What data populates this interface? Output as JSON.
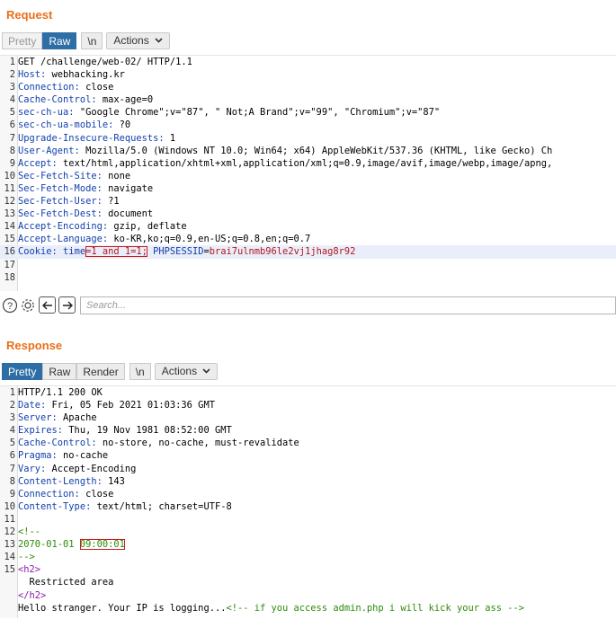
{
  "request": {
    "title": "Request",
    "toolbar": {
      "pretty": "Pretty",
      "raw": "Raw",
      "newline": "\\n",
      "actions": "Actions"
    },
    "lines": [
      {
        "n": "1",
        "parts": [
          {
            "t": "GET /challenge/web-02/ HTTP/1.1",
            "c": "hv"
          }
        ]
      },
      {
        "n": "2",
        "parts": [
          {
            "t": "Host:",
            "c": "hk"
          },
          {
            "t": " webhacking.kr",
            "c": "hv"
          }
        ]
      },
      {
        "n": "3",
        "parts": [
          {
            "t": "Connection:",
            "c": "hk"
          },
          {
            "t": " close",
            "c": "hv"
          }
        ]
      },
      {
        "n": "4",
        "parts": [
          {
            "t": "Cache-Control:",
            "c": "hk"
          },
          {
            "t": " max-age=0",
            "c": "hv"
          }
        ]
      },
      {
        "n": "5",
        "parts": [
          {
            "t": "sec-ch-ua:",
            "c": "hk"
          },
          {
            "t": " \"Google Chrome\";v=\"87\", \" Not;A Brand\";v=\"99\", \"Chromium\";v=\"87\"",
            "c": "hv"
          }
        ]
      },
      {
        "n": "6",
        "parts": [
          {
            "t": "sec-ch-ua-mobile:",
            "c": "hk"
          },
          {
            "t": " ?0",
            "c": "hv"
          }
        ]
      },
      {
        "n": "7",
        "parts": [
          {
            "t": "Upgrade-Insecure-Requests:",
            "c": "hk"
          },
          {
            "t": " 1",
            "c": "hv"
          }
        ]
      },
      {
        "n": "8",
        "parts": [
          {
            "t": "User-Agent:",
            "c": "hk"
          },
          {
            "t": " Mozilla/5.0 (Windows NT 10.0; Win64; x64) AppleWebKit/537.36 (KHTML, like Gecko) Ch",
            "c": "hv"
          }
        ]
      },
      {
        "n": "9",
        "parts": [
          {
            "t": "Accept:",
            "c": "hk"
          },
          {
            "t": " text/html,application/xhtml+xml,application/xml;q=0.9,image/avif,image/webp,image/apng,",
            "c": "hv"
          }
        ]
      },
      {
        "n": "10",
        "parts": [
          {
            "t": "Sec-Fetch-Site:",
            "c": "hk"
          },
          {
            "t": " none",
            "c": "hv"
          }
        ]
      },
      {
        "n": "11",
        "parts": [
          {
            "t": "Sec-Fetch-Mode:",
            "c": "hk"
          },
          {
            "t": " navigate",
            "c": "hv"
          }
        ]
      },
      {
        "n": "12",
        "parts": [
          {
            "t": "Sec-Fetch-User:",
            "c": "hk"
          },
          {
            "t": " ?1",
            "c": "hv"
          }
        ]
      },
      {
        "n": "13",
        "parts": [
          {
            "t": "Sec-Fetch-Dest:",
            "c": "hk"
          },
          {
            "t": " document",
            "c": "hv"
          }
        ]
      },
      {
        "n": "14",
        "parts": [
          {
            "t": "Accept-Encoding:",
            "c": "hk"
          },
          {
            "t": " gzip, deflate",
            "c": "hv"
          }
        ]
      },
      {
        "n": "15",
        "parts": [
          {
            "t": "Accept-Language:",
            "c": "hk"
          },
          {
            "t": " ko-KR,ko;q=0.9,en-US;q=0.8,en;q=0.7",
            "c": "hv"
          }
        ]
      },
      {
        "n": "16",
        "selected": true,
        "parts": [
          {
            "t": "Cookie:",
            "c": "hk"
          },
          {
            "t": " time",
            "c": "ck"
          },
          {
            "t": "=1 and 1=1;",
            "c": "cv",
            "boxed": true
          },
          {
            "t": " PHPSESSID",
            "c": "ck"
          },
          {
            "t": "=",
            "c": "hv"
          },
          {
            "t": "brai7ulnmb96le2vj1jhag8r92",
            "c": "cv"
          }
        ]
      },
      {
        "n": "17",
        "parts": []
      },
      {
        "n": "18",
        "parts": []
      }
    ]
  },
  "search": {
    "placeholder": "Search..."
  },
  "response": {
    "title": "Response",
    "toolbar": {
      "pretty": "Pretty",
      "raw": "Raw",
      "render": "Render",
      "newline": "\\n",
      "actions": "Actions"
    },
    "lines": [
      {
        "n": "1",
        "parts": [
          {
            "t": "HTTP/1.1 200 OK",
            "c": "hv"
          }
        ]
      },
      {
        "n": "2",
        "parts": [
          {
            "t": "Date:",
            "c": "hk"
          },
          {
            "t": " Fri, 05 Feb 2021 01:03:36 GMT",
            "c": "hv"
          }
        ]
      },
      {
        "n": "3",
        "parts": [
          {
            "t": "Server:",
            "c": "hk"
          },
          {
            "t": " Apache",
            "c": "hv"
          }
        ]
      },
      {
        "n": "4",
        "parts": [
          {
            "t": "Expires:",
            "c": "hk"
          },
          {
            "t": " Thu, 19 Nov 1981 08:52:00 GMT",
            "c": "hv"
          }
        ]
      },
      {
        "n": "5",
        "parts": [
          {
            "t": "Cache-Control:",
            "c": "hk"
          },
          {
            "t": " no-store, no-cache, must-revalidate",
            "c": "hv"
          }
        ]
      },
      {
        "n": "6",
        "parts": [
          {
            "t": "Pragma:",
            "c": "hk"
          },
          {
            "t": " no-cache",
            "c": "hv"
          }
        ]
      },
      {
        "n": "7",
        "parts": [
          {
            "t": "Vary:",
            "c": "hk"
          },
          {
            "t": " Accept-Encoding",
            "c": "hv"
          }
        ]
      },
      {
        "n": "8",
        "parts": [
          {
            "t": "Content-Length:",
            "c": "hk"
          },
          {
            "t": " 143",
            "c": "hv"
          }
        ]
      },
      {
        "n": "9",
        "parts": [
          {
            "t": "Connection:",
            "c": "hk"
          },
          {
            "t": " close",
            "c": "hv"
          }
        ]
      },
      {
        "n": "10",
        "parts": [
          {
            "t": "Content-Type:",
            "c": "hk"
          },
          {
            "t": " text/html; charset=UTF-8",
            "c": "hv"
          }
        ]
      },
      {
        "n": "11",
        "parts": []
      },
      {
        "n": "12",
        "parts": [
          {
            "t": "<!--",
            "c": "cm"
          }
        ]
      },
      {
        "n": "13",
        "parts": [
          {
            "t": "2070-01-01 ",
            "c": "cm"
          },
          {
            "t": "09:00:01",
            "c": "cm",
            "boxed": true
          }
        ]
      },
      {
        "n": "14",
        "parts": [
          {
            "t": "-->",
            "c": "cm"
          }
        ]
      },
      {
        "n": "15",
        "parts": [
          {
            "t": "<h2>",
            "c": "tg"
          }
        ]
      },
      {
        "n": "",
        "parts": [
          {
            "t": "  Restricted area",
            "c": "hv"
          }
        ]
      },
      {
        "n": "",
        "parts": [
          {
            "t": "</h2>",
            "c": "tg"
          }
        ]
      },
      {
        "n": "",
        "parts": [
          {
            "t": "Hello stranger. Your IP is logging...",
            "c": "hv"
          },
          {
            "t": "<!-- if you access admin.php i will kick your ass -->",
            "c": "cm"
          }
        ]
      }
    ]
  },
  "colors": {
    "accent": "#e8701a",
    "active_tab": "#2e6ea6",
    "box": "#d01a1a",
    "header_key": "#123fad",
    "cookie_value": "#b4161d",
    "comment": "#2e8b0a",
    "tag": "#8a1aa8"
  }
}
